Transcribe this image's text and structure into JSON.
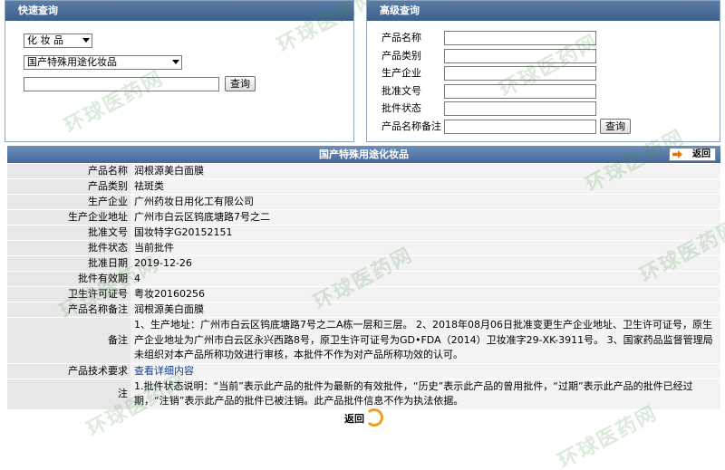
{
  "quick_search": {
    "title": "快速查询",
    "category_select": "化 妆 品",
    "subcategory_select": "国产特殊用途化妆品",
    "keyword_value": "",
    "search_button": "查询"
  },
  "advanced_search": {
    "title": "高级查询",
    "fields": [
      {
        "label": "产品名称",
        "value": ""
      },
      {
        "label": "产品类别",
        "value": ""
      },
      {
        "label": "生产企业",
        "value": ""
      },
      {
        "label": "批准文号",
        "value": ""
      },
      {
        "label": "批件状态",
        "value": ""
      },
      {
        "label": "产品名称备注",
        "value": ""
      }
    ],
    "search_button": "查询"
  },
  "result": {
    "title": "国产特殊用途化妆品",
    "back_label": "返回",
    "rows": [
      {
        "key": "产品名称",
        "value": "润根源美白面膜"
      },
      {
        "key": "产品类别",
        "value": "祛斑类"
      },
      {
        "key": "生产企业",
        "value": "广州药妆日用化工有限公司"
      },
      {
        "key": "生产企业地址",
        "value": "广州市白云区钨底塘路7号之二"
      },
      {
        "key": "批准文号",
        "value": "国妆特字G20152151"
      },
      {
        "key": "批件状态",
        "value": "当前批件"
      },
      {
        "key": "批准日期",
        "value": "2019-12-26"
      },
      {
        "key": "批件有效期",
        "value": "4"
      },
      {
        "key": "卫生许可证号",
        "value": "粤妆20160256"
      },
      {
        "key": "产品名称备注",
        "value": "润根源美白面膜"
      },
      {
        "key": "备注",
        "value": "1、生产地址：广州市白云区钨底塘路7号之二A栋一层和三层。 2、2018年08月06日批准变更生产企业地址、卫生许可证号，原生产企业地址为广州市白云区永兴西路8号，原卫生许可证号为GD•FDA（2014）卫妆准字29-XK-3911号。 3、国家药品监督管理局未组织对本产品所称功效进行审核，本批件不作为对产品所称功效的认可。"
      },
      {
        "key": "产品技术要求",
        "value": "查看详细内容"
      },
      {
        "key": "注",
        "value": "1.批件状态说明：“当前”表示此产品的批件为最新的有效批件，“历史”表示此产品的曾用批件，“过期”表示此产品的批件已经过期，“注销”表示此产品的批件已被注销。此产品批件信息不作为执法依据。"
      }
    ],
    "bottom_back": "返回"
  },
  "watermark": "环球医药网",
  "colors": {
    "header": "#46689a",
    "key_bg": "#e7e7e7",
    "value_bg": "#f3f3f3",
    "back_arrow": "#e07810"
  }
}
